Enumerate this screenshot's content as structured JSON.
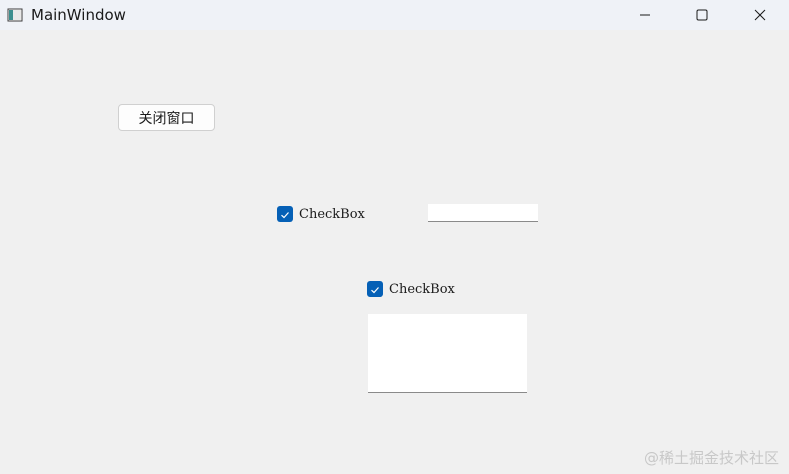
{
  "window": {
    "title": "MainWindow",
    "icon": "app-window-icon",
    "controls": {
      "minimize_icon": "minimize-icon",
      "maximize_icon": "maximize-icon",
      "close_icon": "close-icon"
    }
  },
  "content": {
    "close_button_label": "关闭窗口",
    "checkbox1": {
      "label": "CheckBox",
      "checked": true
    },
    "checkbox2": {
      "label": "CheckBox",
      "checked": true
    },
    "line_edit": {
      "value": ""
    },
    "text_edit": {
      "value": ""
    }
  },
  "watermark": "@稀土掘金技术社区",
  "colors": {
    "accent": "#0560b6",
    "background": "#f0f0f0",
    "titlebar": "#eff2f7"
  }
}
